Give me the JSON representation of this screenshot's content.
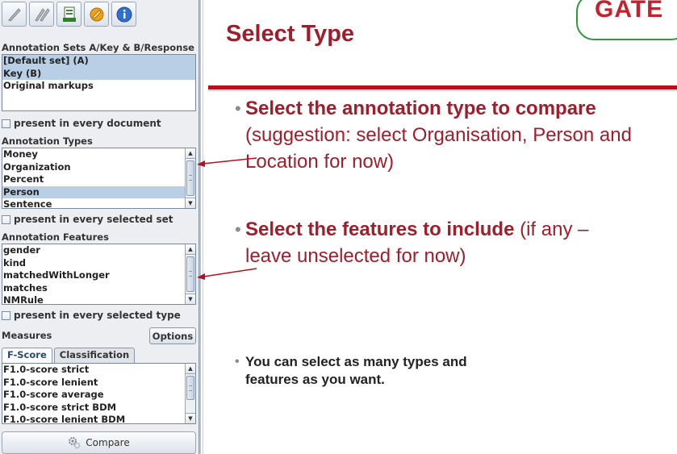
{
  "panel": {
    "toolbar_icons": [
      "feather-icon",
      "feather-double-icon",
      "document-export-icon",
      "settings-wizard-icon",
      "info-icon"
    ],
    "annotation_sets_label": "Annotation Sets A/Key & B/Response",
    "annotation_sets": [
      {
        "label": "[Default set] (A)",
        "selected": true
      },
      {
        "label": "Key (B)",
        "selected": true
      },
      {
        "label": "Original markups",
        "selected": false
      }
    ],
    "present_every_document": "present in every document",
    "annotation_types_label": "Annotation Types",
    "annotation_types": [
      {
        "label": "Money",
        "selected": false
      },
      {
        "label": "Organization",
        "selected": false
      },
      {
        "label": "Percent",
        "selected": false
      },
      {
        "label": "Person",
        "selected": true
      },
      {
        "label": "Sentence",
        "selected": false
      }
    ],
    "present_every_set": "present in every selected set",
    "annotation_features_label": "Annotation Features",
    "annotation_features": [
      {
        "label": "gender",
        "selected": false
      },
      {
        "label": "kind",
        "selected": false
      },
      {
        "label": "matchedWithLonger",
        "selected": false
      },
      {
        "label": "matches",
        "selected": false
      },
      {
        "label": "NMRule",
        "selected": false
      }
    ],
    "present_every_type": "present in every selected type",
    "measures_label": "Measures",
    "options_button": "Options",
    "tabs": [
      {
        "label": "F-Score",
        "active": true
      },
      {
        "label": "Classification",
        "active": false
      }
    ],
    "measures": [
      "F1.0-score strict",
      "F1.0-score lenient",
      "F1.0-score average",
      "F1.0-score strict BDM",
      "F1.0-score lenient BDM"
    ],
    "compare_button": "Compare"
  },
  "slide": {
    "title": "Select Type",
    "logo_text": "GATE",
    "bullet1_bold": "Select the annotation type to compare",
    "bullet1_rest": " (suggestion: select Organisation, Person and Location for now)",
    "bullet2_bold": "Select the features to include",
    "bullet2_rest": " (if any – leave unselected for now)",
    "bullet3": "You can select as many types and features as you want.",
    "colors": {
      "title": "#a01e2b",
      "rule": "#b5101e",
      "logo_border": "#2f9a3a",
      "logo_text": "#c81f2c"
    }
  }
}
